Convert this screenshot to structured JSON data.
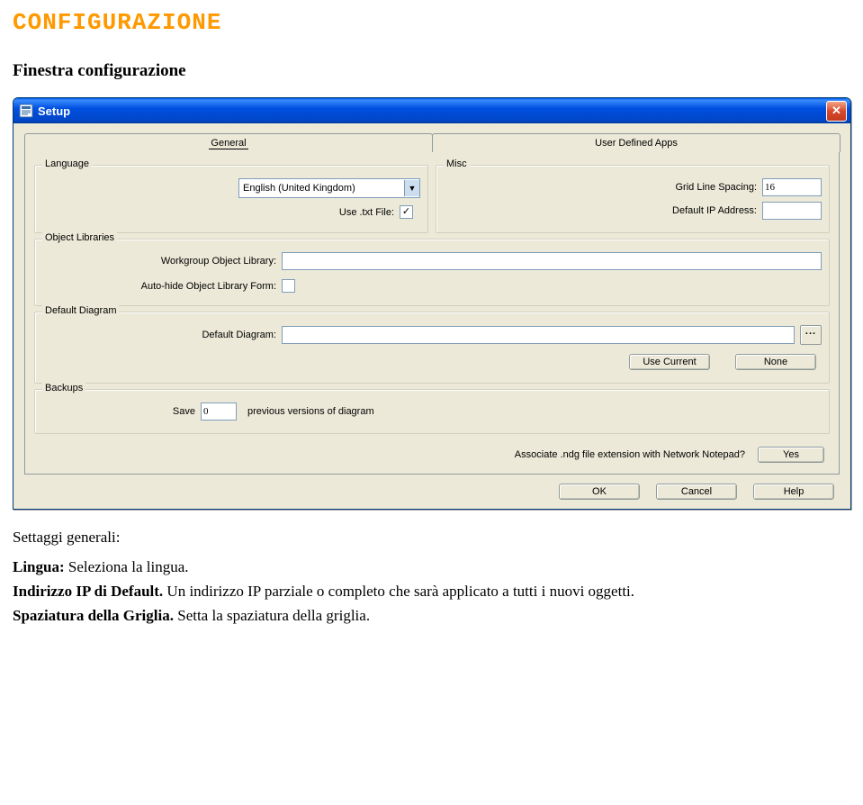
{
  "page": {
    "title": "CONFIGURAZIONE",
    "subtitle": "Finestra configurazione"
  },
  "dialog": {
    "title": "Setup",
    "tabs": {
      "general": "General",
      "uda": "User Defined Apps"
    },
    "groups": {
      "language": {
        "title": "Language",
        "lang_value": "English (United Kingdom)",
        "use_txt_label": "Use .txt File:",
        "use_txt_checked": "✓"
      },
      "misc": {
        "title": "Misc",
        "grid_label": "Grid Line Spacing:",
        "grid_value": "16",
        "ip_label": "Default IP Address:",
        "ip_value": ""
      },
      "objlib": {
        "title": "Object Libraries",
        "wg_label": "Workgroup Object Library:",
        "wg_value": "",
        "autohide_label": "Auto-hide Object Library Form:",
        "autohide_checked": ""
      },
      "defdiag": {
        "title": "Default Diagram",
        "label": "Default Diagram:",
        "value": "",
        "browse": "...",
        "use_current": "Use Current",
        "none": "None"
      },
      "backups": {
        "title": "Backups",
        "save_label": "Save",
        "save_value": "0",
        "save_suffix": "previous versions of diagram"
      }
    },
    "assoc": {
      "label": "Associate .ndg file extension with Network Notepad?",
      "yes": "Yes"
    },
    "buttons": {
      "ok": "OK",
      "cancel": "Cancel",
      "help": "Help"
    }
  },
  "desc": {
    "heading": "Settaggi generali:",
    "lines": [
      {
        "b": "Lingua:",
        "t": " Seleziona la lingua."
      },
      {
        "b": "Indirizzo IP di Default.",
        "t": " Un indirizzo IP parziale o completo che sarà applicato a tutti i nuovi oggetti."
      },
      {
        "b": "Spaziatura della Griglia.",
        "t": " Setta la spaziatura della griglia."
      }
    ]
  }
}
